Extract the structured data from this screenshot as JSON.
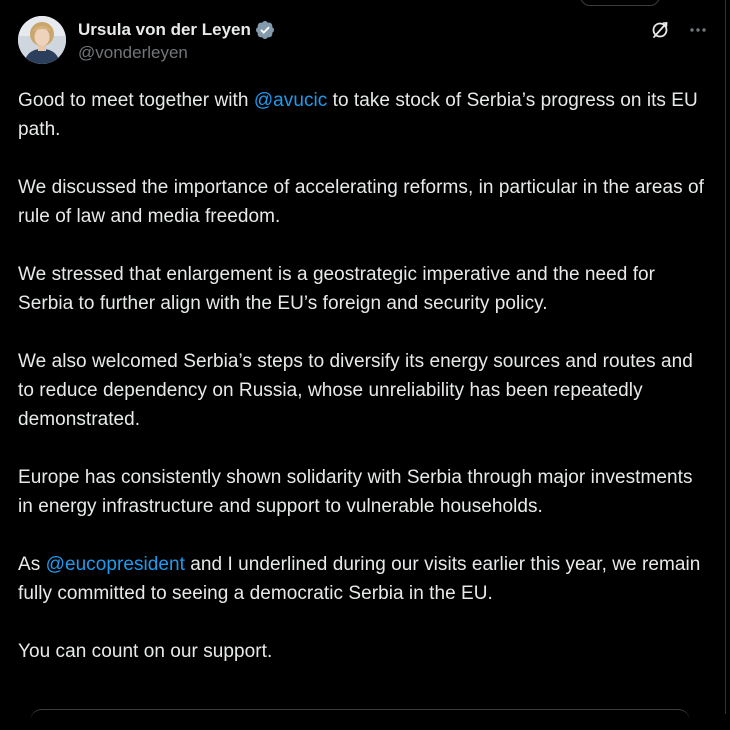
{
  "author": {
    "display_name": "Ursula von der Leyen",
    "handle": "@vonderleyen",
    "verified_badge_icon": "verified-badge-icon",
    "avatar_alt": "avatar"
  },
  "header_actions": {
    "grok_icon": "grok-icon",
    "more_icon": "more-options-icon"
  },
  "colors": {
    "background": "#000000",
    "text": "#e7e9ea",
    "secondary_text": "#71767b",
    "link": "#1d9bf0",
    "verified": "#829aab"
  },
  "tweet": {
    "p1_before": "Good to meet together with ",
    "p1_mention": "@avucic",
    "p1_after": " to take stock of Serbia’s progress on its EU path.",
    "p2": "We discussed the importance of accelerating reforms, in particular in the areas of rule of law and media freedom.",
    "p3": "We stressed that enlargement is a geostrategic imperative and the need for Serbia to further align with the EU’s foreign and security policy.",
    "p4": "We also welcomed Serbia’s steps to diversify its energy sources and routes and to reduce dependency on Russia, whose unreliability has been repeatedly demonstrated.",
    "p5": "Europe has consistently shown solidarity with Serbia through major investments in energy infrastructure and support to vulnerable households.",
    "p6_before": "As ",
    "p6_mention": "@eucopresident",
    "p6_after": " and I underlined during our visits earlier this year, we remain fully committed to seeing a democratic Serbia in the EU.",
    "p7": "You can count on our support."
  }
}
